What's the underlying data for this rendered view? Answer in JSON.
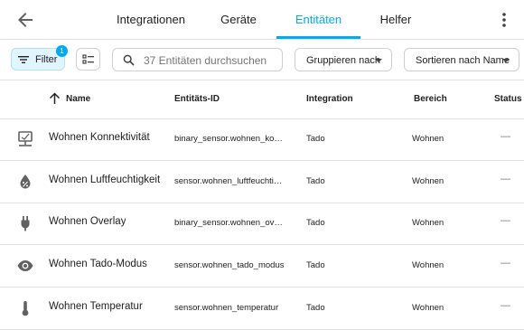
{
  "header": {
    "tabs": [
      {
        "label": "Integrationen"
      },
      {
        "label": "Geräte"
      },
      {
        "label": "Entitäten"
      },
      {
        "label": "Helfer"
      }
    ],
    "active_tab": "Entitäten"
  },
  "toolbar": {
    "filter_label": "Filter",
    "filter_count": "1",
    "search_placeholder": "37 Entitäten durchsuchen",
    "group_label": "Gruppieren nach",
    "sort_label": "Sortieren nach Name"
  },
  "table": {
    "columns": [
      "Name",
      "Entitäts-ID",
      "Integration",
      "Bereich",
      "Status"
    ],
    "rows": [
      {
        "icon": "monitor-network-icon",
        "name": "Wohnen Konnektivität",
        "entity_id": "binary_sensor.wohnen_konnektivitaet",
        "integration": "Tado",
        "area": "Wohnen",
        "status": "—"
      },
      {
        "icon": "water-percent-icon",
        "name": "Wohnen Luftfeuchtigkeit",
        "entity_id": "sensor.wohnen_luftfeuchtigkeit",
        "integration": "Tado",
        "area": "Wohnen",
        "status": "—"
      },
      {
        "icon": "power-plug-icon",
        "name": "Wohnen Overlay",
        "entity_id": "binary_sensor.wohnen_overlay",
        "integration": "Tado",
        "area": "Wohnen",
        "status": "—"
      },
      {
        "icon": "eye-icon",
        "name": "Wohnen Tado-Modus",
        "entity_id": "sensor.wohnen_tado_modus",
        "integration": "Tado",
        "area": "Wohnen",
        "status": "—"
      },
      {
        "icon": "thermometer-icon",
        "name": "Wohnen Temperatur",
        "entity_id": "sensor.wohnen_temperatur",
        "integration": "Tado",
        "area": "Wohnen",
        "status": "—"
      }
    ]
  },
  "colors": {
    "accent": "#03a9f4",
    "filter_bg": "#e1f5fe",
    "icon": "#616161"
  }
}
